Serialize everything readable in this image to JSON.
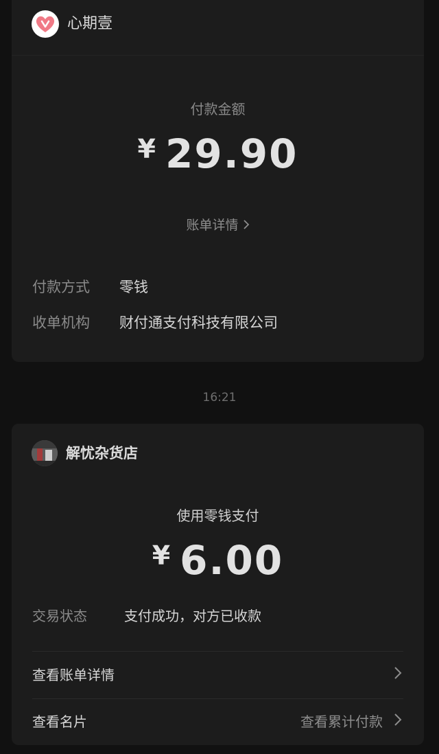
{
  "receipt1": {
    "merchant_name": "心期壹",
    "amount_label": "付款金额",
    "currency": "¥",
    "amount": "29.90",
    "bill_detail_link": "账单详情",
    "payment_method_label": "付款方式",
    "payment_method_value": "零钱",
    "acquirer_label": "收单机构",
    "acquirer_value": "财付通支付科技有限公司"
  },
  "timestamp": "16:21",
  "receipt2": {
    "merchant_name": "解忧杂货店",
    "pay_method_caption": "使用零钱支付",
    "currency": "¥",
    "amount": "6.00",
    "status_label": "交易状态",
    "status_value": "支付成功，对方已收款",
    "view_bill_label": "查看账单详情",
    "view_card_label": "查看名片",
    "view_total_label": "查看累计付款"
  },
  "colors": {
    "background": "#111111",
    "card": "#1c1c1c",
    "logo_heart": "#f07a86"
  },
  "icons": [
    "heart-logo-icon",
    "chevron-right-icon",
    "merchant-avatar"
  ]
}
